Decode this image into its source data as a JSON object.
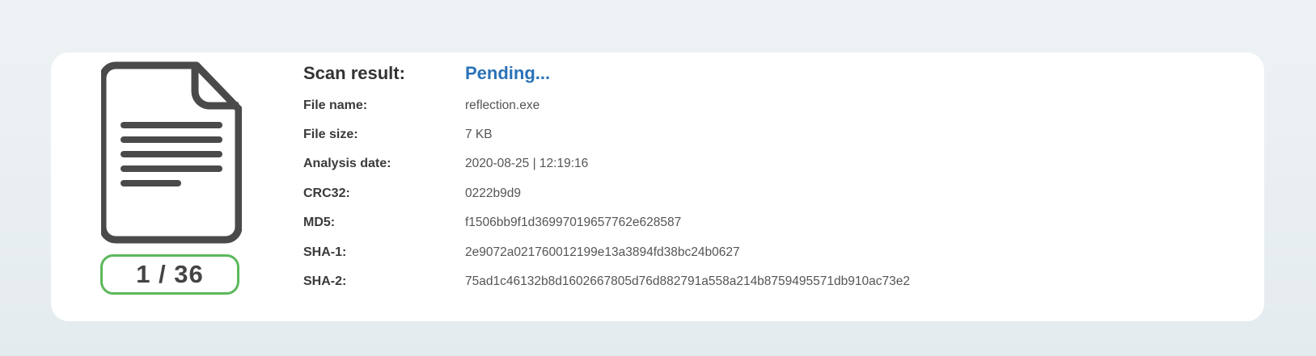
{
  "scan": {
    "result_label": "Scan result:",
    "result_value": "Pending...",
    "counter": "1 / 36"
  },
  "details": {
    "file_name": {
      "label": "File name:",
      "value": "reflection.exe"
    },
    "file_size": {
      "label": "File size:",
      "value": "7 KB"
    },
    "analysis_date": {
      "label": "Analysis date:",
      "value": "2020-08-25 | 12:19:16"
    },
    "crc32": {
      "label": "CRC32:",
      "value": "0222b9d9"
    },
    "md5": {
      "label": "MD5:",
      "value": "f1506bb9f1d36997019657762e628587"
    },
    "sha1": {
      "label": "SHA-1:",
      "value": "2e9072a021760012199e13a3894fd38bc24b0627"
    },
    "sha2": {
      "label": "SHA-2:",
      "value": "75ad1c46132b8d1602667805d76d882791a558a214b8759495571db910ac73e2"
    }
  },
  "colors": {
    "pending": "#2a72b8",
    "counter_border": "#5cb85c",
    "icon": "#4a4a4a"
  },
  "icons": {
    "file": "document-icon"
  }
}
